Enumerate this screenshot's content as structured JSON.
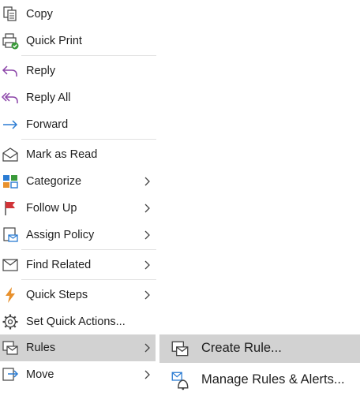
{
  "menu": {
    "items": [
      {
        "label": "Copy",
        "icon": "copy-icon",
        "submenu": false
      },
      {
        "label": "Quick Print",
        "icon": "quick-print-icon",
        "submenu": false
      },
      {
        "label": "Reply",
        "icon": "reply-icon",
        "submenu": false
      },
      {
        "label": "Reply All",
        "icon": "reply-all-icon",
        "submenu": false
      },
      {
        "label": "Forward",
        "icon": "forward-icon",
        "submenu": false
      },
      {
        "label": "Mark as Read",
        "icon": "envelope-open-icon",
        "submenu": false
      },
      {
        "label": "Categorize",
        "icon": "categorize-icon",
        "submenu": true
      },
      {
        "label": "Follow Up",
        "icon": "flag-icon",
        "submenu": true
      },
      {
        "label": "Assign Policy",
        "icon": "policy-icon",
        "submenu": true
      },
      {
        "label": "Find Related",
        "icon": "find-related-icon",
        "submenu": true
      },
      {
        "label": "Quick Steps",
        "icon": "lightning-icon",
        "submenu": true
      },
      {
        "label": "Set Quick Actions...",
        "icon": "gear-icon",
        "submenu": false
      },
      {
        "label": "Rules",
        "icon": "rules-icon",
        "submenu": true,
        "active": true
      },
      {
        "label": "Move",
        "icon": "move-icon",
        "submenu": true
      }
    ]
  },
  "submenu": {
    "items": [
      {
        "label": "Create Rule...",
        "icon": "create-rule-icon"
      },
      {
        "label": "Manage Rules & Alerts...",
        "icon": "manage-rules-icon"
      }
    ]
  },
  "colors": {
    "hover": "#d2d2d2",
    "reply": "#8b44a8",
    "forward": "#2b7cd3",
    "flag": "#d13438",
    "lightning": "#e8912d"
  }
}
